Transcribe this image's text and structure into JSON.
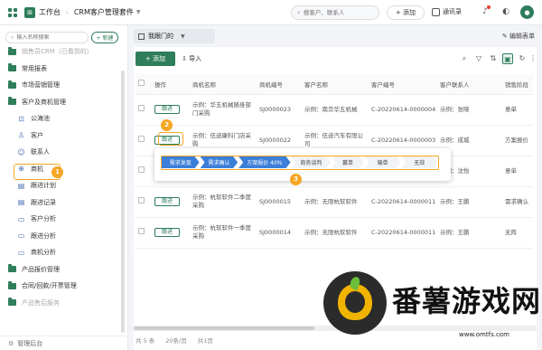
{
  "topbar": {
    "app_logo_char": "⊞",
    "app_title": "工作台",
    "separator": "›",
    "suite_title": "CRM客户管理套件",
    "search_placeholder": "搜客户、联系人",
    "add_label": "+ 添加",
    "contacts_label": "通讯录",
    "avatar_char": "●"
  },
  "sidebar": {
    "search_placeholder": "输入名称搜索",
    "new_label": "+ 新建",
    "items": [
      {
        "label": "销售员CRM（已看到的）",
        "level": 1,
        "icon": "folder-icon",
        "faded": true
      },
      {
        "label": "常用报表",
        "level": 1,
        "icon": "folder-icon"
      },
      {
        "label": "市场营销管理",
        "level": 1,
        "icon": "folder-icon"
      },
      {
        "label": "客户及商机管理",
        "level": 1,
        "icon": "folder-icon"
      },
      {
        "label": "公海池",
        "level": 2,
        "icon": "pool-icon",
        "glyph": "⊡"
      },
      {
        "label": "客户",
        "level": 2,
        "icon": "customer-icon",
        "glyph": "♙"
      },
      {
        "label": "联系人",
        "level": 2,
        "icon": "contact-icon",
        "glyph": "☺"
      },
      {
        "label": "商机",
        "level": 2,
        "icon": "opportunity-icon",
        "glyph": "⊕"
      },
      {
        "label": "跟进计划",
        "level": 2,
        "icon": "plan-icon",
        "glyph": "▤"
      },
      {
        "label": "跟进记录",
        "level": 2,
        "icon": "record-icon",
        "glyph": "▤"
      },
      {
        "label": "客户分析",
        "level": 2,
        "icon": "analysis-icon",
        "glyph": "▭"
      },
      {
        "label": "跟进分析",
        "level": 2,
        "icon": "analysis-icon",
        "glyph": "▭"
      },
      {
        "label": "商机分析",
        "level": 2,
        "icon": "analysis-icon",
        "glyph": "▭"
      },
      {
        "label": "产品报价管理",
        "level": 1,
        "icon": "folder-icon"
      },
      {
        "label": "合同/回款/开票管理",
        "level": 1,
        "icon": "folder-icon"
      },
      {
        "label": "产品售后服务",
        "level": 1,
        "icon": "folder-icon",
        "faded": true
      }
    ],
    "footer_label": "管理后台"
  },
  "view": {
    "tab_label": "我跟门的",
    "edit_label": "编辑表单"
  },
  "toolbar": {
    "new_label": "+ 添加",
    "import_label": "导入"
  },
  "table": {
    "headers": [
      "",
      "操作",
      "商机名称",
      "商机编号",
      "客户名称",
      "客户编号",
      "客户联系人",
      "销售阶段"
    ],
    "rows": [
      {
        "action": "跟进",
        "name": "示例：华五机械随身部门采购",
        "code": "SJ0000023",
        "customer": "示例：南京华五机械",
        "cust_code": "C-20220614-0000004",
        "contact": "示例：张晓",
        "stage": "意单"
      },
      {
        "action": "跟进",
        "name": "示例：伍迪康科门店采购",
        "code": "SJ0000022",
        "customer": "示例：伍迪汽车有限公司",
        "cust_code": "C-20220614-0000003",
        "contact": "示例：成城",
        "stage": "方案报价"
      },
      {
        "action": "跟进",
        "name": "[示例]",
        "code": "",
        "customer": "技有限公司",
        "cust_code": "",
        "contact": "示例：沈怡",
        "stage": "意单"
      },
      {
        "action": "跟进",
        "name": "示例：杭软软件二季度采购",
        "code": "SJ0000015",
        "customer": "示例：无限杭软软件",
        "cust_code": "C-20220614-0000011",
        "contact": "示例：王鹏",
        "stage": "需求确认"
      },
      {
        "action": "跟进",
        "name": "示例：杭软软件一季度采购",
        "code": "SJ0000014",
        "customer": "示例：无限杭软软件",
        "cust_code": "C-20220614-0000011",
        "contact": "示例：王鹏",
        "stage": "无阵"
      }
    ]
  },
  "stages": [
    {
      "label": "需求发现",
      "done": true
    },
    {
      "label": "需求确认",
      "done": true
    },
    {
      "label": "方案报价 40%",
      "done": true
    },
    {
      "label": "商务谈判",
      "done": false
    },
    {
      "label": "赢单",
      "done": false
    },
    {
      "label": "输单",
      "done": false
    },
    {
      "label": "无效",
      "done": false
    }
  ],
  "badges": {
    "one": "1",
    "two": "2",
    "three": "3"
  },
  "pager": {
    "total": "共 5 条",
    "size": "20条/页",
    "page": "共1页"
  },
  "watermark": {
    "text": "番薯游戏网",
    "url": "www.omtfs.com"
  },
  "colors": {
    "brand": "#2e7d5b",
    "highlight": "#f5a623",
    "stage_done": "#3b7fd9"
  }
}
